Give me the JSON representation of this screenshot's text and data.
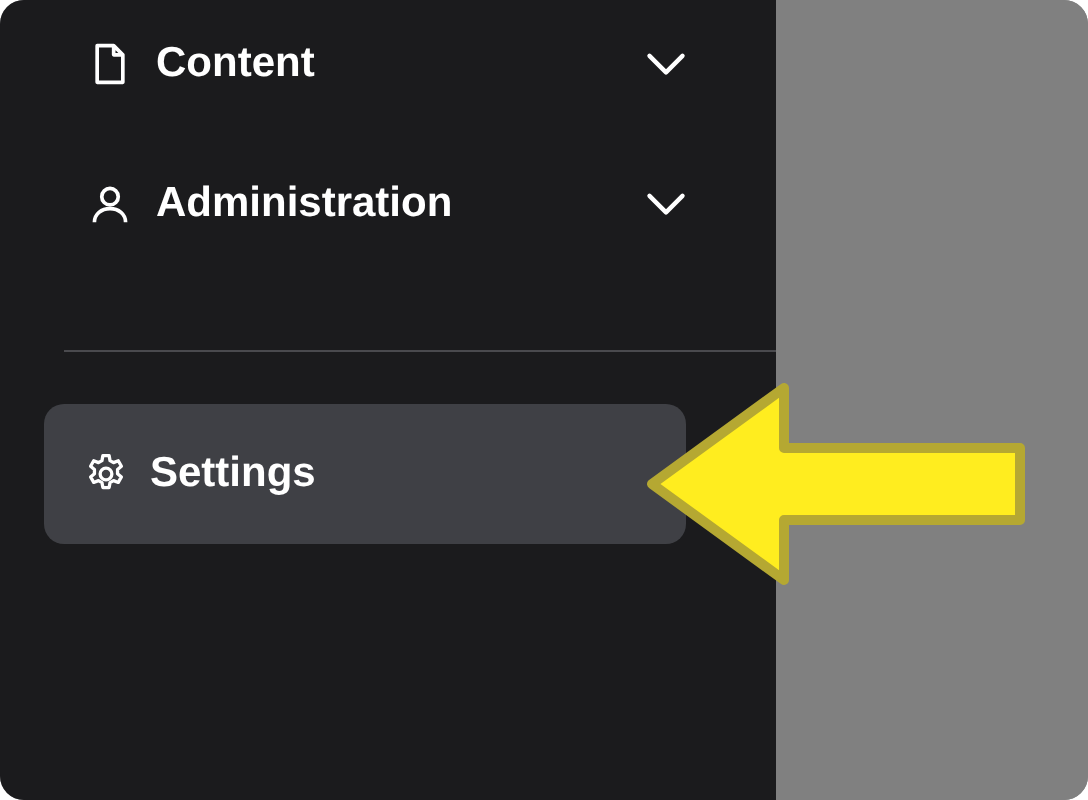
{
  "nav": {
    "items": [
      {
        "label": "Content",
        "expanded": false,
        "selected": false
      },
      {
        "label": "Administration",
        "expanded": false,
        "selected": false
      }
    ]
  },
  "footer": {
    "items": [
      {
        "label": "Settings",
        "selected": true
      }
    ]
  },
  "annotation": {
    "kind": "arrow"
  }
}
